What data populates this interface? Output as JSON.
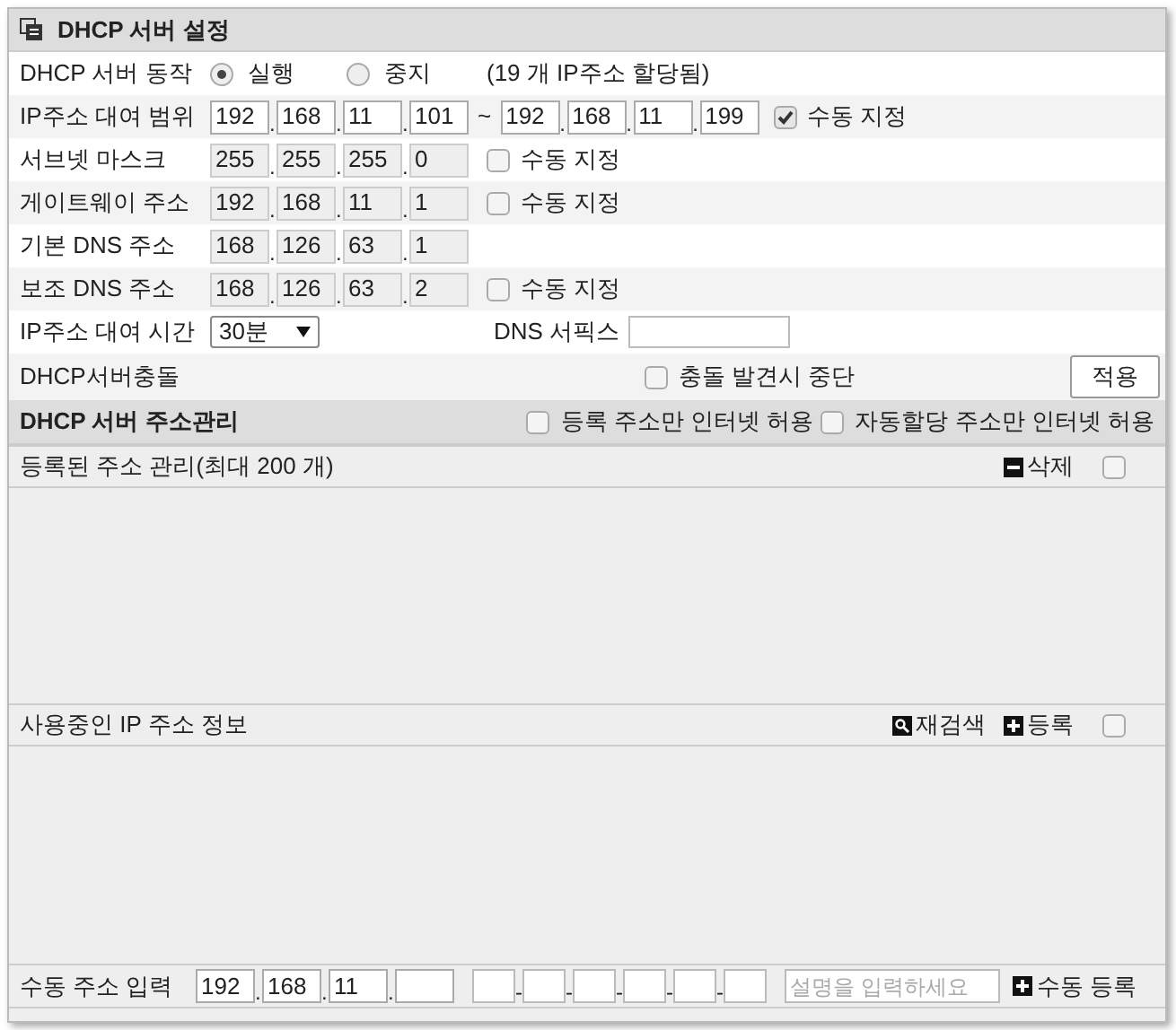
{
  "header": {
    "title": "DHCP 서버 설정"
  },
  "separators": {
    "octet": ".",
    "mac": "-"
  },
  "server_action": {
    "label": "DHCP 서버 동작",
    "options": [
      {
        "label": "실행",
        "selected": true
      },
      {
        "label": "중지",
        "selected": false
      }
    ],
    "note": "(19 개 IP주소 할당됨)"
  },
  "ip_range": {
    "label": "IP주소 대여 범위",
    "start": [
      "192",
      "168",
      "11",
      "101"
    ],
    "separator": "~",
    "end": [
      "192",
      "168",
      "11",
      "199"
    ],
    "manual": {
      "label": "수동 지정",
      "checked": true
    }
  },
  "address_rows": [
    {
      "label": "서브넷 마스크",
      "octets": [
        "255",
        "255",
        "255",
        "0"
      ],
      "disabled": true,
      "manual": {
        "label": "수동 지정",
        "checked": false
      }
    },
    {
      "label": "게이트웨이 주소",
      "octets": [
        "192",
        "168",
        "11",
        "1"
      ],
      "disabled": true,
      "manual": {
        "label": "수동 지정",
        "checked": false
      }
    },
    {
      "label": "기본 DNS 주소",
      "octets": [
        "168",
        "126",
        "63",
        "1"
      ],
      "disabled": true
    },
    {
      "label": "보조 DNS 주소",
      "octets": [
        "168",
        "126",
        "63",
        "2"
      ],
      "disabled": true,
      "manual": {
        "label": "수동 지정",
        "checked": false
      }
    }
  ],
  "lease": {
    "label": "IP주소 대여 시간",
    "value": "30분",
    "dns_suffix": {
      "label": "DNS 서픽스"
    }
  },
  "conflict": {
    "label": "DHCP서버충돌",
    "stop_option": {
      "label": "충돌 발견시 중단",
      "checked": false
    },
    "apply_button": "적용"
  },
  "management": {
    "title": "DHCP 서버 주소관리",
    "options": [
      {
        "label": "등록 주소만 인터넷 허용",
        "checked": false
      },
      {
        "label": "자동할당 주소만 인터넷 허용",
        "checked": false
      }
    ]
  },
  "registered": {
    "title": "등록된 주소 관리(최대 200 개)",
    "actions": [
      {
        "label": "삭제",
        "kind": "minus"
      }
    ],
    "select_all": {
      "checked": false
    }
  },
  "in_use": {
    "title": "사용중인 IP 주소 정보",
    "actions": [
      {
        "label": "재검색",
        "kind": "search"
      },
      {
        "label": "등록",
        "kind": "plus"
      }
    ],
    "select_all": {
      "checked": false
    }
  },
  "manual_entry": {
    "label": "수동 주소 입력",
    "octets": [
      "192",
      "168",
      "11"
    ],
    "description": {
      "placeholder": "설명을 입력하세요"
    },
    "submit": {
      "label": "수동 등록",
      "kind": "plus"
    }
  }
}
